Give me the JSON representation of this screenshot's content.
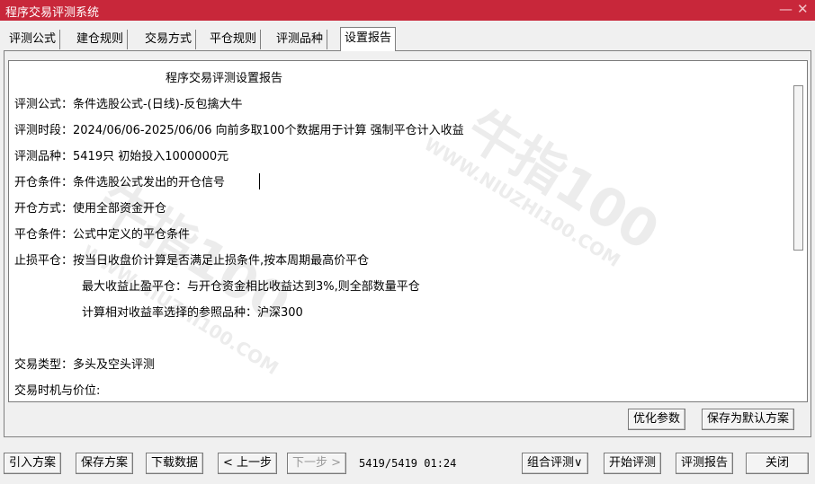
{
  "window": {
    "title": "程序交易评测系统",
    "minimize": "—",
    "close": "✕"
  },
  "tabs": [
    "评测公式",
    "建仓规则",
    "交易方式",
    "平仓规则",
    "评测品种",
    "设置报告"
  ],
  "report": {
    "heading": "程序交易评测设置报告",
    "lines": [
      "评测公式：条件选股公式-(日线)-反包擒大牛",
      "评测时段：2024/06/06-2025/06/06 向前多取100个数据用于计算 强制平仓计入收益",
      "评测品种：5419只 初始投入1000000元",
      "开仓条件：条件选股公式发出的开仓信号",
      "开仓方式：使用全部资金开仓",
      "平仓条件：公式中定义的平仓条件",
      "止损平仓：按当日收盘价计算是否满足止损条件,按本周期最高价平仓",
      "最大收益止盈平仓：与开仓资金相比收益达到3%,则全部数量平仓",
      "计算相对收益率选择的参照品种：沪深300",
      "",
      "交易类型：多头及空头评测",
      "交易时机与价位:"
    ]
  },
  "watermark": {
    "brand": "牛指100",
    "site": "WWW.NIUZHI100.COM"
  },
  "panel_buttons": {
    "optimize": "优化参数",
    "save_default": "保存为默认方案"
  },
  "bottom": {
    "import": "引入方案",
    "save_plan": "保存方案",
    "download": "下载数据",
    "prev": "< 上一步",
    "next": "下一步 >",
    "status": "5419/5419 01:24",
    "combo": "组合评测∨",
    "start": "开始评测",
    "report": "评测报告",
    "close": "关闭"
  }
}
